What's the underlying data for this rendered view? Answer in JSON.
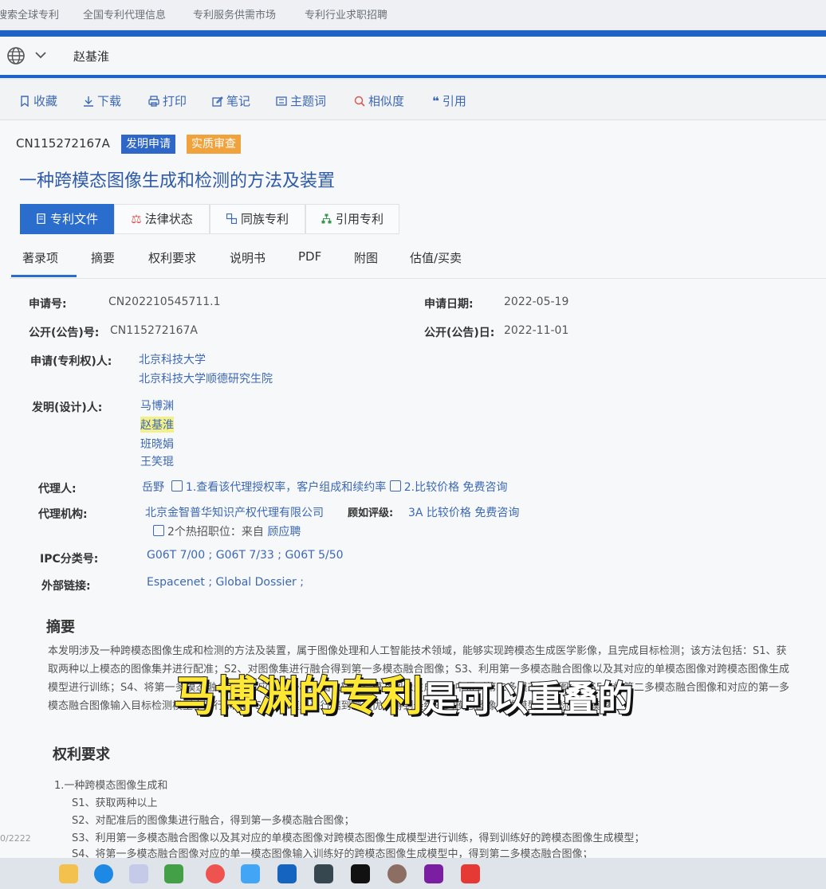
{
  "topnav": [
    "搜索全球专利",
    "全国专利代理信息",
    "专利服务供需市场",
    "专利行业求职招聘"
  ],
  "search": {
    "value": "赵基淮"
  },
  "toolbar": [
    "收藏",
    "下载",
    "打印",
    "笔记",
    "主题词",
    "相似度",
    "引用"
  ],
  "patent": {
    "pub_no": "CN115272167A",
    "badges": [
      "发明申请",
      "实质审查"
    ],
    "title": "一种跨模态图像生成和检测的方法及装置"
  },
  "tabs": [
    "专利文件",
    "法律状态",
    "同族专利",
    "引用专利"
  ],
  "subtabs": [
    "著录项",
    "摘要",
    "权利要求",
    "说明书",
    "PDF",
    "附图",
    "估值/买卖"
  ],
  "biblio": {
    "app_no_label": "申请号:",
    "app_no": "CN202210545711.1",
    "app_date_label": "申请日期:",
    "app_date": "2022-05-19",
    "pub_no_label": "公开(公告)号:",
    "pub_no": "CN115272167A",
    "pub_date_label": "公开(公告)日:",
    "pub_date": "2022-11-01",
    "applicant_label": "申请(专利权)人:",
    "applicants": [
      "北京科技大学",
      "北京科技大学顺德研究生院"
    ],
    "inventor_label": "发明(设计)人:",
    "inventors": [
      "马博渊",
      "赵基淮",
      "班晓娟",
      "王笑琨"
    ],
    "agent_label": "代理人:",
    "agent": "岳野",
    "agent_link1": "1.查看该代理授权率，客户组成和续约率",
    "agent_link2": "2.比较价格 免费咨询",
    "agency_label": "代理机构:",
    "agency": "北京金智普华知识产权代理有限公司",
    "rating_label": "顾如评级:",
    "rating": "3A 比较价格 免费咨询",
    "jobs": "2个热招职位：来自",
    "jobs_source": "顾应聘",
    "ipc_label": "IPC分类号:",
    "ipc": "G06T 7/00 ; G06T 7/33 ; G06T 5/50",
    "ext_label": "外部链接:",
    "ext": "Espacenet ; Global Dossier ;"
  },
  "abstract": {
    "heading": "摘要",
    "text": "本发明涉及一种跨模态图像生成和检测的方法及装置，属于图像处理和人工智能技术领域，能够实现跨模态生成医学影像，且完成目标检测；该方法包括：S1、获取两种以上模态的图像集并进行配准；S2、对图像集进行融合得到第一多模态融合图像；S3、利用第一多模态融合图像以及其对应的单模态图像对跨模态图像生成模型进行训练；S4、将第一多模态融合图像对应的单一模态图像输入跨模态图像生成模型中得到第二多模态融合图像；S5、将第二多模态融合图像和对应的第一多模态融合图像输入目标检测模型中进行训练；S6、对模型进行端到端调优，得到最终的跨模态图像生成模型和目标检测模型。"
  },
  "claims": {
    "heading": "权利要求",
    "lines": [
      "1.一种跨模态图像生成和",
      "S1、获取两种以上",
      "S2、对配准后的图像集进行融合，得到第一多模态融合图像；",
      "S3、利用第一多模态融合图像以及其对应的单模态图像对跨模态图像生成模型进行训练，得到训练好的跨模态图像生成模型；",
      "S4、将第一多模态融合图像对应的单一模态图像输入训练好的跨模态图像生成模型中，得到第二多模态融合图像；"
    ]
  },
  "caption": {
    "yellow": "马博渊的专利",
    "white": "是可以重叠的"
  },
  "page_indicator": "0/2222"
}
